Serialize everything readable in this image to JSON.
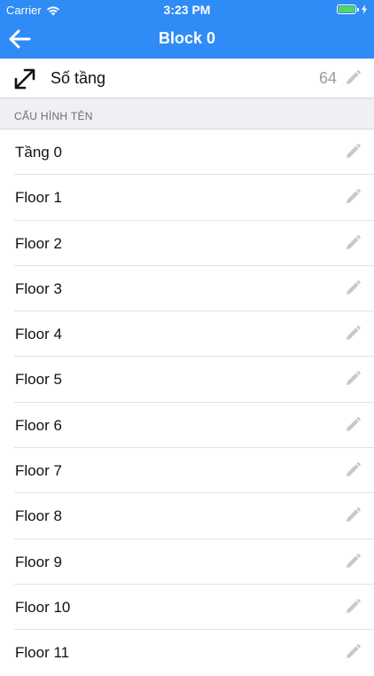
{
  "status_bar": {
    "carrier": "Carrier",
    "time": "3:23 PM"
  },
  "nav": {
    "title": "Block 0",
    "back_icon": "arrow-left-icon"
  },
  "floor_count": {
    "label": "Số tầng",
    "value": "64",
    "icon": "diagonal-resize-icon"
  },
  "section": {
    "header": "CẤU HÌNH TÊN"
  },
  "floors": [
    {
      "name": "Tầng 0"
    },
    {
      "name": "Floor 1"
    },
    {
      "name": "Floor 2"
    },
    {
      "name": "Floor 3"
    },
    {
      "name": "Floor 4"
    },
    {
      "name": "Floor 5"
    },
    {
      "name": "Floor 6"
    },
    {
      "name": "Floor 7"
    },
    {
      "name": "Floor 8"
    },
    {
      "name": "Floor 9"
    },
    {
      "name": "Floor 10"
    },
    {
      "name": "Floor 11"
    }
  ],
  "colors": {
    "accent": "#2f8bf5",
    "section_bg": "#efeff4",
    "battery": "#4cd964",
    "muted_text": "#9b9b9b"
  }
}
